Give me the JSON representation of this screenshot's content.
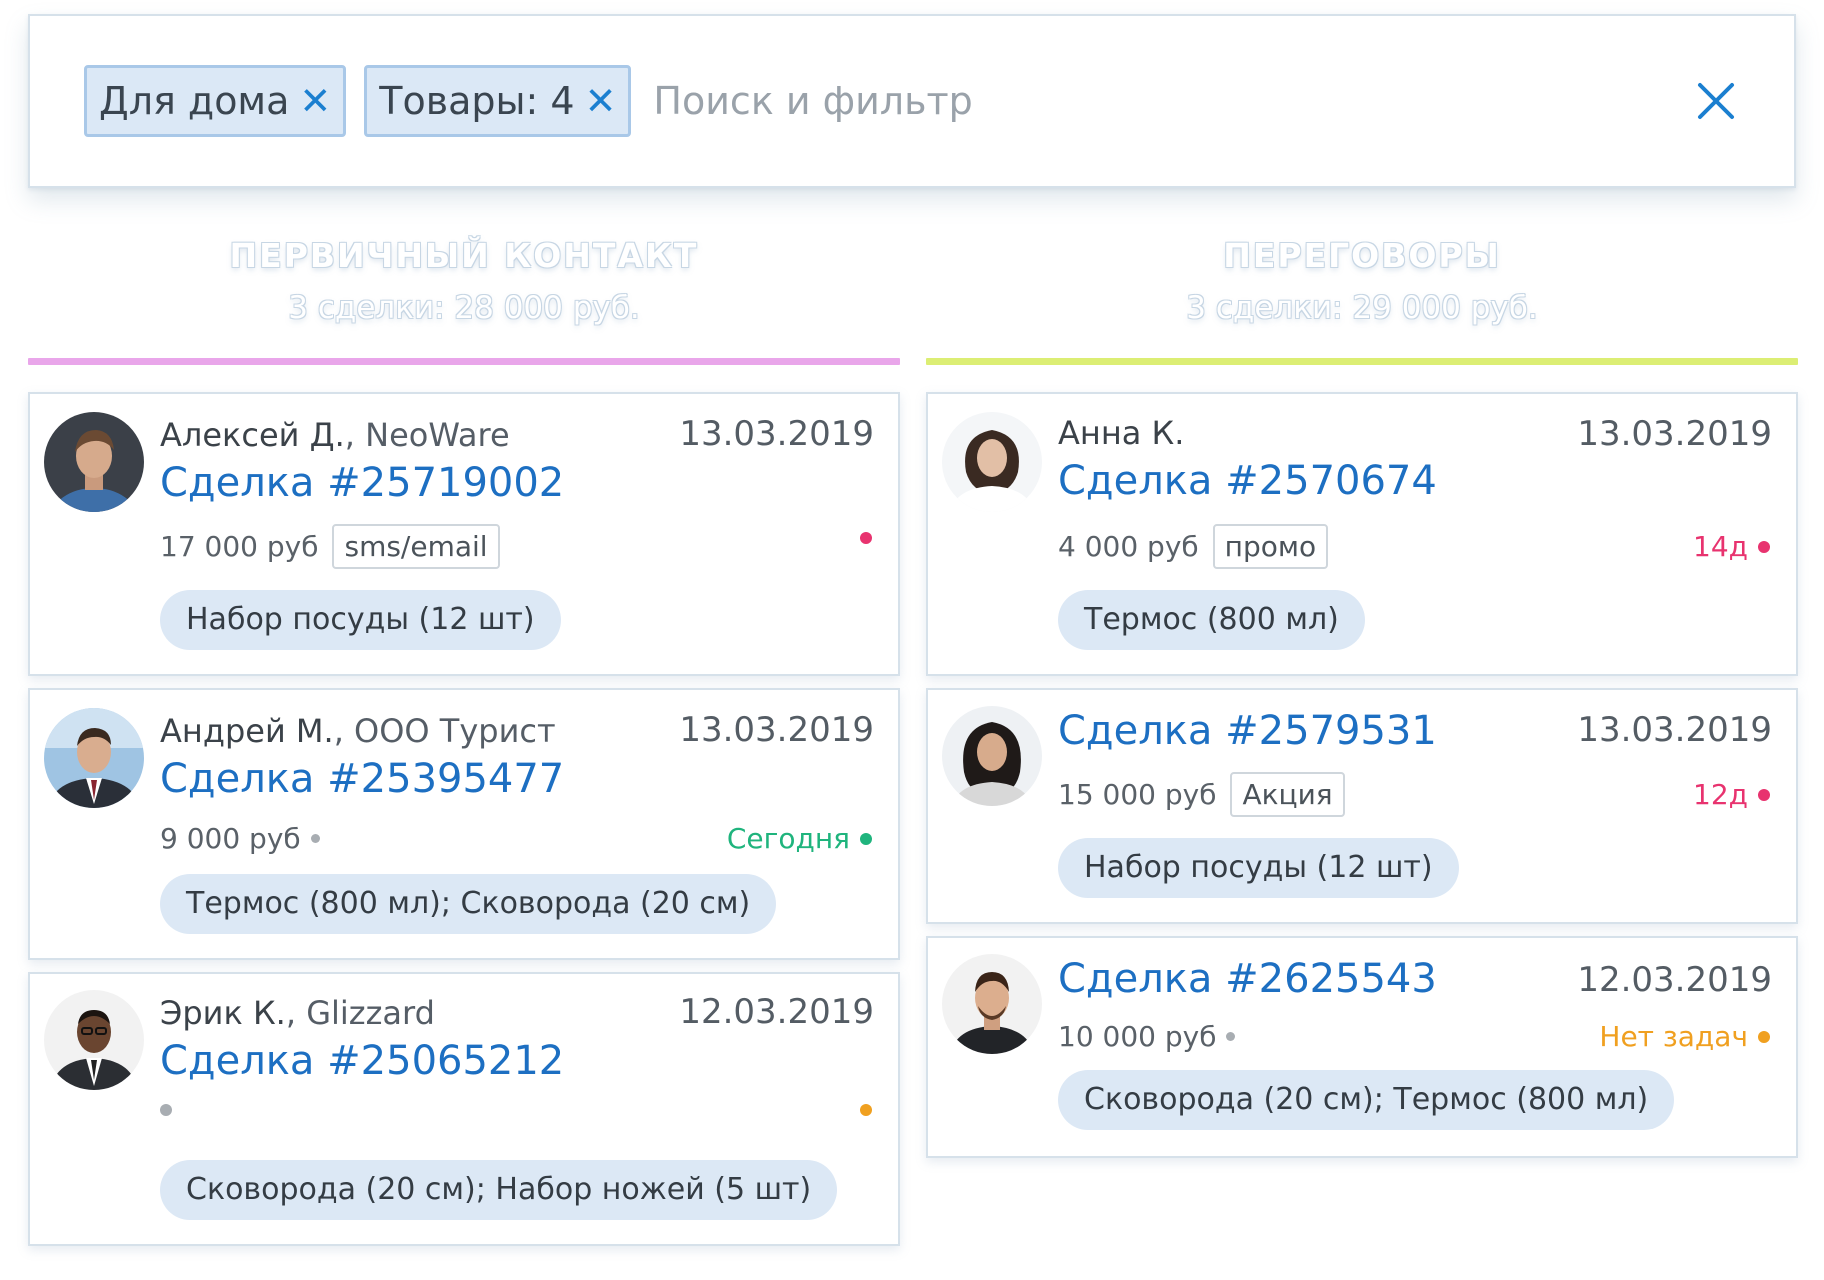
{
  "filter": {
    "chips": [
      {
        "label": "Для дома"
      },
      {
        "label": "Товары: 4"
      }
    ],
    "chip_close_glyph": "✕",
    "placeholder": "Поиск и фильтр"
  },
  "columns": [
    {
      "title": "ПЕРВИЧНЫЙ КОНТАКТ",
      "summary": "3 сделки: 28 000 руб.",
      "accent_color": "#e9a6ea",
      "cards": [
        {
          "name": "Алексей Д.",
          "company": ", NeoWare",
          "date": "13.03.2019",
          "deal": "Сделка #25719002",
          "amount": "17 000 руб",
          "tag": "sms/email",
          "status": "",
          "status_color": "#e8336f",
          "products": "Набор посуды (12 шт)"
        },
        {
          "name": "Андрей М.",
          "company": ", ООО Турист",
          "date": "13.03.2019",
          "deal": "Сделка #25395477",
          "amount": "9 000 руб",
          "tag": "",
          "status": "Сегодня",
          "status_color": "#1fb47d",
          "products": "Термос (800 мл); Сковорода (20 см)"
        },
        {
          "name": "Эрик К.",
          "company": ", Glizzard",
          "date": "12.03.2019",
          "deal": "Сделка #25065212",
          "amount": "",
          "tag": "",
          "status": "",
          "status_color": "#f0a020",
          "products": "Сковорода (20 см); Набор ножей (5 шт)"
        }
      ]
    },
    {
      "title": "ПЕРЕГОВОРЫ",
      "summary": "3 сделки: 29 000 руб.",
      "accent_color": "#dcee74",
      "cards": [
        {
          "name": "Анна К.",
          "company": "",
          "date": "13.03.2019",
          "deal": "Сделка #2570674",
          "amount": "4 000 руб",
          "tag": "промо",
          "status": "14д",
          "status_color": "#e8336f",
          "products": "Термос (800 мл)"
        },
        {
          "name": "",
          "company": "",
          "date": "13.03.2019",
          "deal": "Сделка #2579531",
          "amount": "15 000 руб",
          "tag": "Акция",
          "status": "12д",
          "status_color": "#e8336f",
          "products": "Набор посуды (12 шт)"
        },
        {
          "name": "",
          "company": "",
          "date": "12.03.2019",
          "deal": "Сделка #2625543",
          "amount": "10 000 руб",
          "tag": "",
          "status": "Нет задач",
          "status_color": "#f0a020",
          "products": "Сковорода (20 см); Термос (800 мл)"
        }
      ]
    }
  ]
}
